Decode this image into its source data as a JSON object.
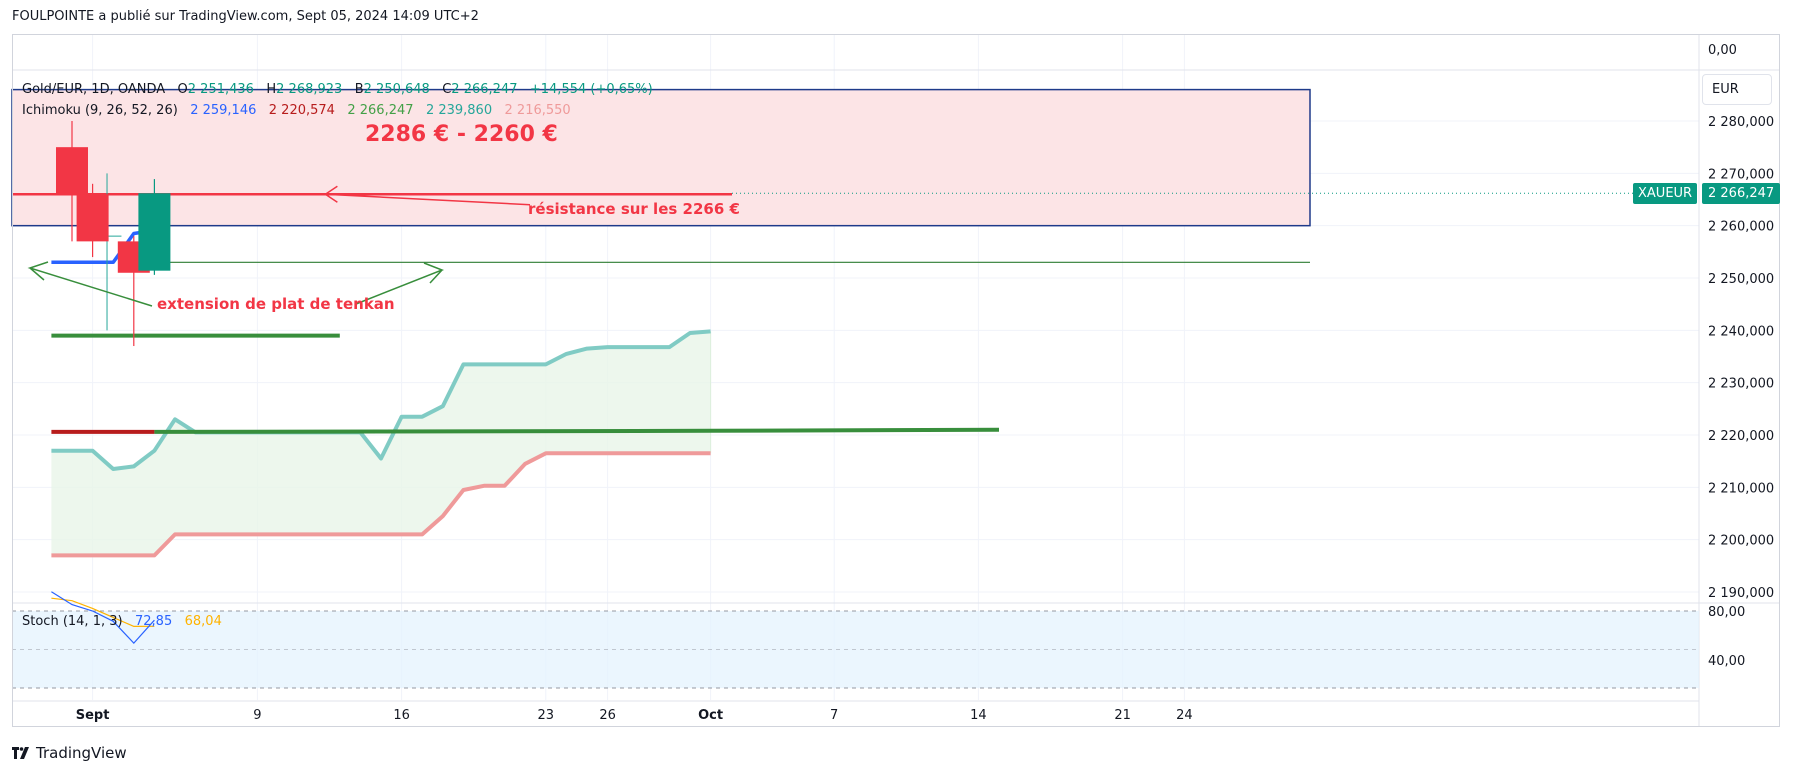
{
  "header": {
    "publisher_line": "FOULPOINTE a publié sur TradingView.com, Sept 05, 2024 14:09 UTC+2"
  },
  "legend": {
    "symbol": "Gold/EUR, 1D, OANDA",
    "o_label": "O",
    "o_value": "2 251,436",
    "h_label": "H",
    "h_value": "2 268,923",
    "b_label": "B",
    "b_value": "2 250,648",
    "c_label": "C",
    "c_value": "2 266,247",
    "change": "+14,554 (+0,65%)",
    "ichimoku_label": "Ichimoku (9, 26, 52, 26)",
    "ichimoku_values": [
      "2 259,146",
      "2 220,574",
      "2 266,247",
      "2 239,860",
      "2 216,550"
    ],
    "stoch_label": "Stoch (14, 1, 3)",
    "stoch_values": [
      "72,85",
      "68,04"
    ]
  },
  "currency": "EUR",
  "symbol_tag": "XAUEUR",
  "last_price": "2 266,247",
  "zone_label": "2286 € - 2260 €",
  "annotations": {
    "resistance": "résistance sur les 2266 €",
    "tenkan": "extension de plat de tenkan"
  },
  "branding": "TradingView",
  "colors": {
    "up": "#089981",
    "down": "#f23645",
    "tenkan": "#2962ff",
    "kijun": "#b71c1c",
    "chikou": "#43a047",
    "span_a": "#26a69a",
    "span_b": "#ef5350",
    "zone_fill": "#fce4e6",
    "zone_border": "#1e3a8a",
    "stoch_k": "#2962ff",
    "stoch_d": "#ffb300"
  },
  "chart_data": {
    "type": "line",
    "y_ticks": [
      "2 190,000",
      "2 200,000",
      "2 210,000",
      "2 220,000",
      "2 230,000",
      "2 240,000",
      "2 250,000",
      "2 260,000",
      "2 270,000",
      "2 280,000"
    ],
    "y_tick_values": [
      2190,
      2200,
      2210,
      2220,
      2230,
      2240,
      2250,
      2260,
      2270,
      2280
    ],
    "top_tick": "0,00",
    "ylim": [
      2188,
      2290
    ],
    "x_ticks": [
      {
        "label": "Sept",
        "day": 1,
        "bold": true
      },
      {
        "label": "9",
        "day": 9
      },
      {
        "label": "16",
        "day": 16
      },
      {
        "label": "23",
        "day": 23
      },
      {
        "label": "26",
        "day": 26
      },
      {
        "label": "Oct",
        "day": 31,
        "bold": true
      },
      {
        "label": "7",
        "day": 37
      },
      {
        "label": "14",
        "day": 44
      },
      {
        "label": "21",
        "day": 51
      },
      {
        "label": "24",
        "day": 54
      }
    ],
    "candles": [
      {
        "day": 0,
        "o": 2275,
        "h": 2280,
        "l": 2257,
        "c": 2266
      },
      {
        "day": 1,
        "o": 2266,
        "h": 2268,
        "l": 2254,
        "c": 2257
      },
      {
        "day": 3,
        "o": 2257,
        "h": 2258,
        "l": 2237,
        "c": 2251
      },
      {
        "day": 4,
        "o": 2251.4,
        "h": 2268.9,
        "l": 2250.6,
        "c": 2266.2
      }
    ],
    "tenkan": [
      [
        -1,
        2253
      ],
      [
        1,
        2253
      ],
      [
        2,
        2253
      ],
      [
        3,
        2258.5
      ],
      [
        4,
        2259.1
      ]
    ],
    "kijun": [
      [
        -1,
        2220.6
      ],
      [
        4,
        2220.6
      ]
    ],
    "chikou_lines": [
      [
        [
          -1,
          2239
        ],
        [
          13,
          2239
        ]
      ],
      [
        [
          4,
          2220.6
        ],
        [
          31,
          2220.8
        ],
        [
          45,
          2221
        ]
      ]
    ],
    "senkou_a": [
      [
        -1,
        2217
      ],
      [
        1,
        2217
      ],
      [
        2,
        2213.5
      ],
      [
        3,
        2214
      ],
      [
        4,
        2217
      ],
      [
        5,
        2223
      ],
      [
        6,
        2220.5
      ],
      [
        13,
        2220.5
      ],
      [
        14,
        2220.5
      ],
      [
        15,
        2215.5
      ],
      [
        16,
        2223.5
      ],
      [
        17,
        2223.5
      ],
      [
        18,
        2225.5
      ],
      [
        19,
        2233.5
      ],
      [
        22,
        2233.5
      ],
      [
        23,
        2233.5
      ],
      [
        24,
        2235.5
      ],
      [
        25,
        2236.5
      ],
      [
        26,
        2236.8
      ],
      [
        29,
        2236.8
      ],
      [
        30,
        2239.5
      ],
      [
        31,
        2239.8
      ]
    ],
    "senkou_b": [
      [
        -1,
        2197
      ],
      [
        4,
        2197
      ],
      [
        5,
        2201
      ],
      [
        17,
        2201
      ],
      [
        18,
        2204.5
      ],
      [
        19,
        2209.5
      ],
      [
        20,
        2210.3
      ],
      [
        21,
        2210.3
      ],
      [
        22,
        2214.5
      ],
      [
        23,
        2216.5
      ],
      [
        31,
        2216.5
      ]
    ],
    "resistance_zone": [
      2286,
      2260
    ],
    "resistance_line": 2266,
    "tenkan_flat_line": 2253,
    "stoch_ticks": [
      "80,00",
      "40,00"
    ],
    "stoch_k": [
      [
        -1,
        95
      ],
      [
        0,
        85
      ],
      [
        1,
        80
      ],
      [
        2,
        72
      ],
      [
        3,
        55
      ],
      [
        4,
        72.85
      ]
    ],
    "stoch_d": [
      [
        -1,
        90
      ],
      [
        0,
        88
      ],
      [
        1,
        82
      ],
      [
        2,
        75
      ],
      [
        3,
        68
      ],
      [
        4,
        68.04
      ]
    ]
  }
}
